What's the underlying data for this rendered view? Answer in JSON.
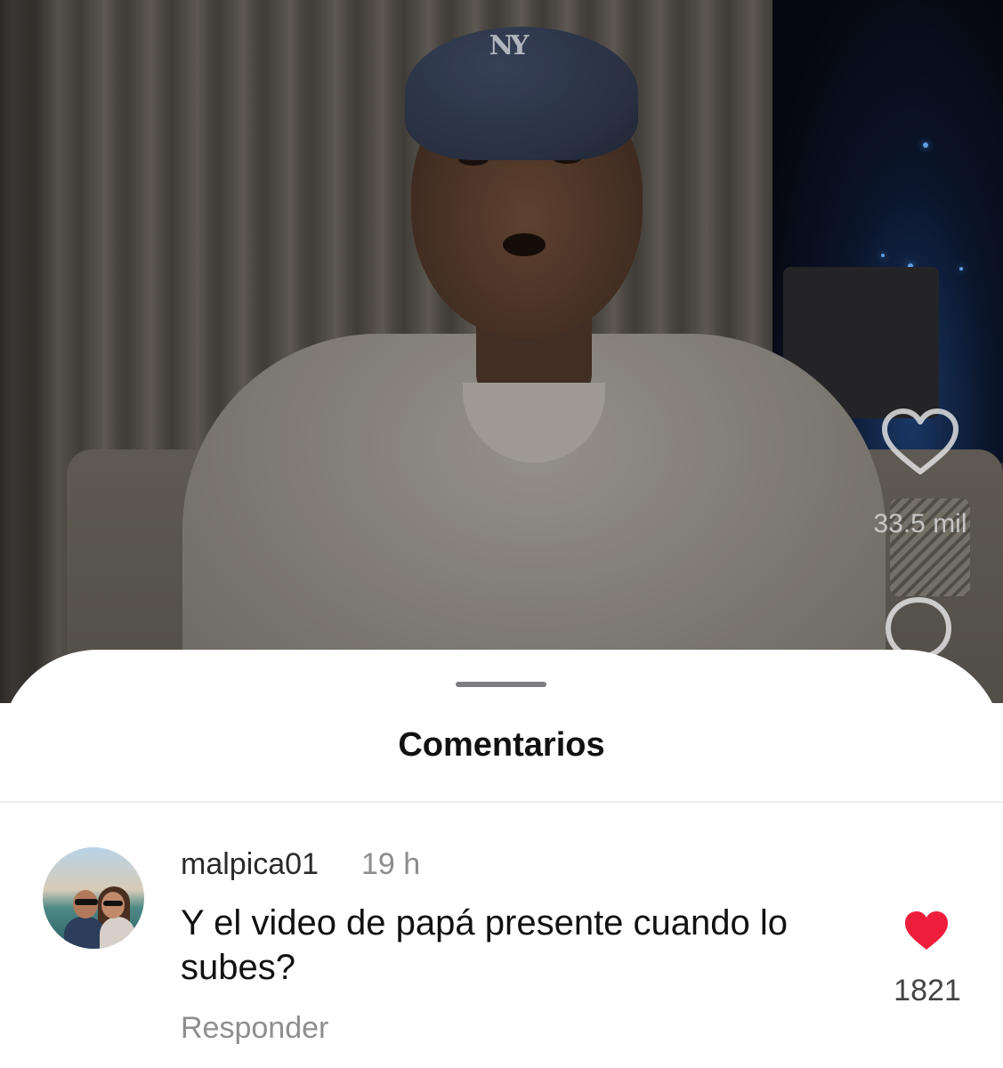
{
  "video": {
    "cap_logo": "NY",
    "actions": {
      "like_icon": "heart-outline-icon",
      "like_count": "33.5 mil",
      "comment_icon": "comment-bubble-icon"
    }
  },
  "comments_sheet": {
    "title": "Comentarios",
    "comments": [
      {
        "username": "malpica01",
        "time": "19 h",
        "text": "Y el video de papá presente cuando lo subes?",
        "reply_label": "Responder",
        "like_icon": "heart-filled-icon",
        "like_count": "1821",
        "like_color": "#ee1d3b"
      }
    ]
  }
}
